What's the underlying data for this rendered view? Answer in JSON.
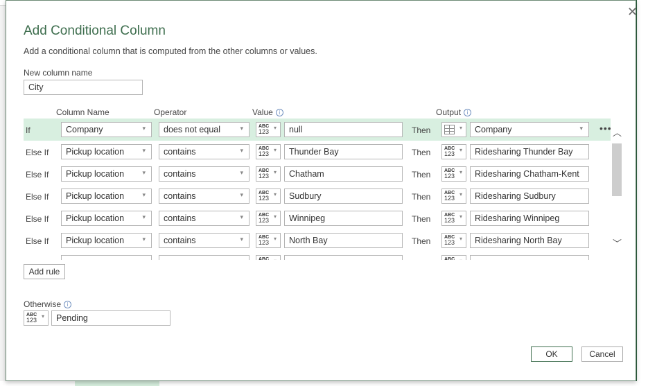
{
  "dialog": {
    "title": "Add Conditional Column",
    "description": "Add a conditional column that is computed from the other columns or values.",
    "close_icon": "close-icon",
    "new_column_label": "New column name",
    "new_column_value": "City",
    "headers": {
      "column_name": "Column Name",
      "operator": "Operator",
      "value": "Value",
      "output": "Output"
    },
    "rules": [
      {
        "label": "If",
        "column": "Company",
        "operator": "does not equal",
        "value_type": "ABC 123",
        "value": "null",
        "then": "Then",
        "output_type": "table-icon",
        "output": "Company",
        "output_is_dropdown": true
      },
      {
        "label": "Else If",
        "column": "Pickup location",
        "operator": "contains",
        "value_type": "ABC 123",
        "value": "Thunder Bay",
        "then": "Then",
        "output_type": "ABC 123",
        "output": "Ridesharing Thunder Bay"
      },
      {
        "label": "Else If",
        "column": "Pickup location",
        "operator": "contains",
        "value_type": "ABC 123",
        "value": "Chatham",
        "then": "Then",
        "output_type": "ABC 123",
        "output": "Ridesharing Chatham-Kent"
      },
      {
        "label": "Else If",
        "column": "Pickup location",
        "operator": "contains",
        "value_type": "ABC 123",
        "value": "Sudbury",
        "then": "Then",
        "output_type": "ABC 123",
        "output": "Ridesharing Sudbury"
      },
      {
        "label": "Else If",
        "column": "Pickup location",
        "operator": "contains",
        "value_type": "ABC 123",
        "value": "Winnipeg",
        "then": "Then",
        "output_type": "ABC 123",
        "output": "Ridesharing Winnipeg"
      },
      {
        "label": "Else If",
        "column": "Pickup location",
        "operator": "contains",
        "value_type": "ABC 123",
        "value": "North Bay",
        "then": "Then",
        "output_type": "ABC 123",
        "output": "Ridesharing North Bay"
      },
      {
        "label": "",
        "column": "",
        "operator": "",
        "value_type": "ABC 123",
        "value": "",
        "then": "",
        "output_type": "ABC 123",
        "output": ""
      }
    ],
    "add_rule": "Add rule",
    "otherwise_label": "Otherwise",
    "otherwise_type": "ABC 123",
    "otherwise_value": "Pending",
    "ok": "OK",
    "cancel": "Cancel",
    "accent": "#3e6e4e",
    "selected_row_bg": "#d8efe0"
  }
}
